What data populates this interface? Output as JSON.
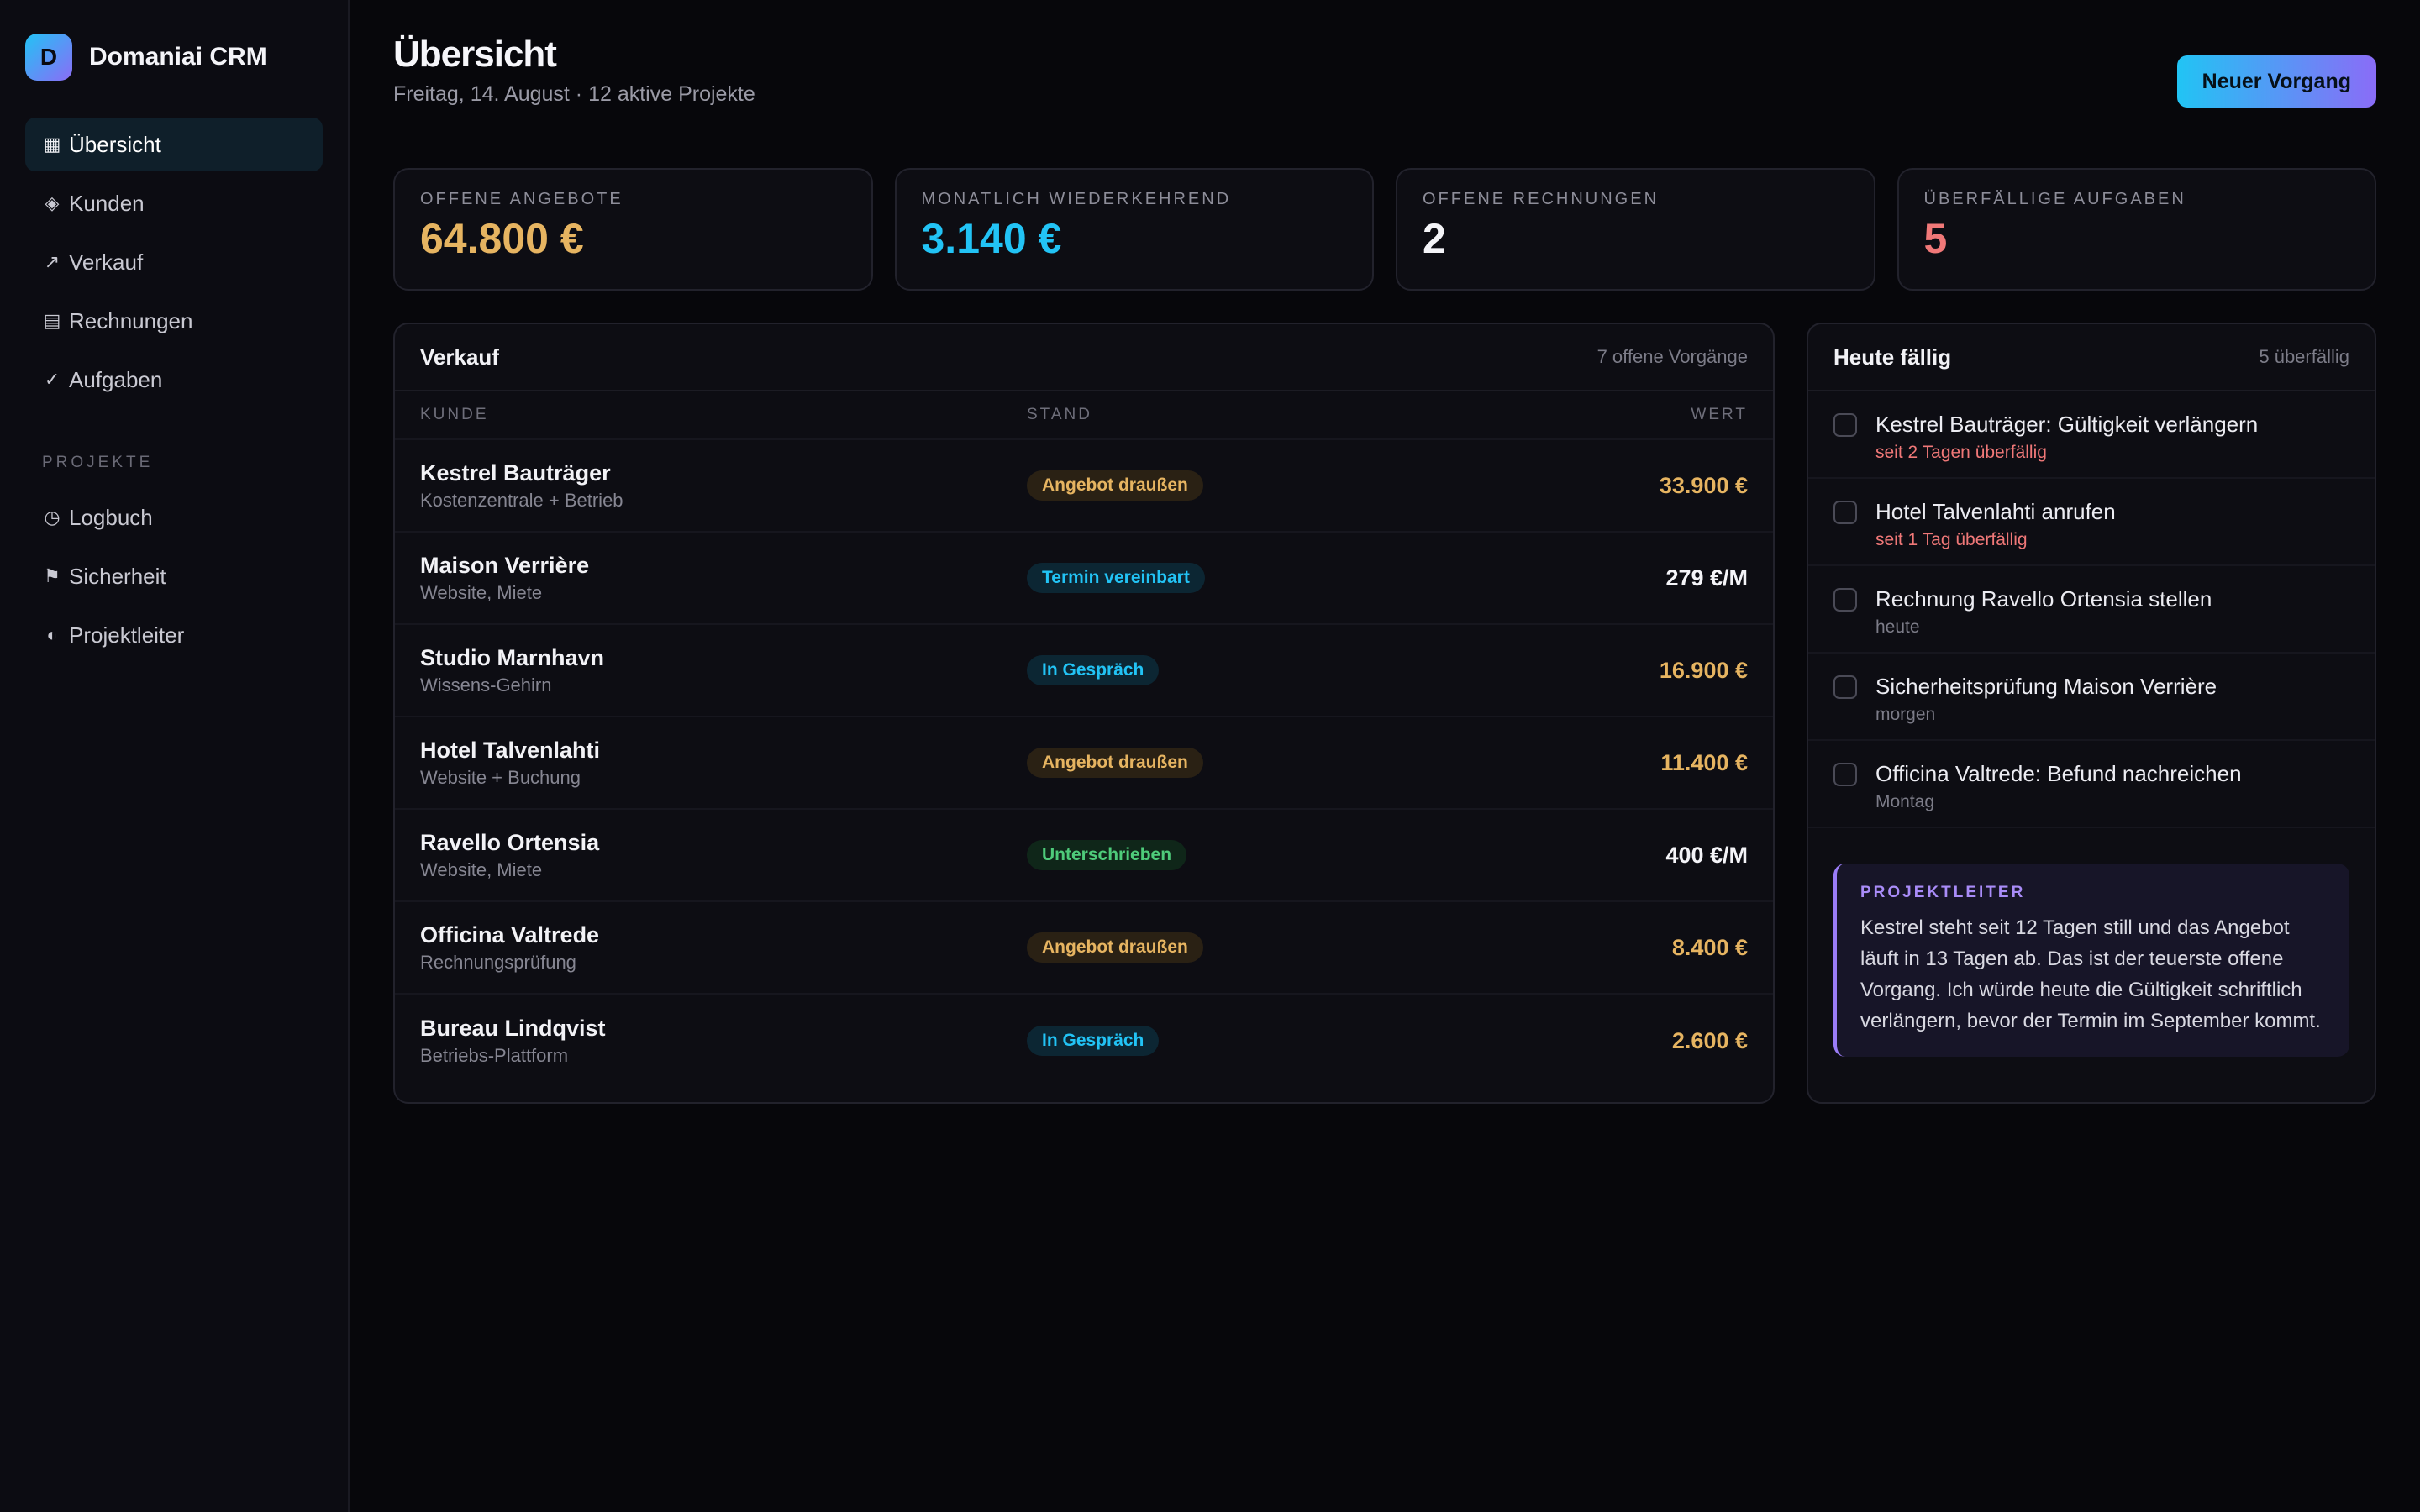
{
  "app": {
    "logo_letter": "D",
    "name": "Domaniai CRM"
  },
  "sidebar": {
    "items": [
      {
        "icon": "▦",
        "label": "Übersicht",
        "active": true
      },
      {
        "icon": "◈",
        "label": "Kunden"
      },
      {
        "icon": "↗",
        "label": "Verkauf"
      },
      {
        "icon": "▤",
        "label": "Rechnungen"
      },
      {
        "icon": "✓",
        "label": "Aufgaben"
      }
    ],
    "section_label": "PROJEKTE",
    "project_items": [
      {
        "icon": "◷",
        "label": "Logbuch"
      },
      {
        "icon": "⚑",
        "label": "Sicherheit"
      },
      {
        "icon": "◐",
        "label": "Projektleiter"
      }
    ]
  },
  "header": {
    "title": "Übersicht",
    "subtitle": "Freitag, 14. August · 12 aktive Projekte",
    "primary_button": "Neuer Vorgang"
  },
  "stats": [
    {
      "label": "OFFENE ANGEBOTE",
      "value": "64.800 €",
      "color": "#e6b461"
    },
    {
      "label": "MONATLICH WIEDERKEHREND",
      "value": "3.140 €",
      "color": "#22c3f5"
    },
    {
      "label": "OFFENE RECHNUNGEN",
      "value": "2",
      "color": "#f4f4f8"
    },
    {
      "label": "ÜBERFÄLLIGE AUFGABEN",
      "value": "5",
      "color": "#f07878"
    }
  ],
  "sales": {
    "title": "Verkauf",
    "meta": "7 offene Vorgänge",
    "columns": {
      "kunde": "KUNDE",
      "stand": "STAND",
      "wert": "WERT"
    },
    "rows": [
      {
        "name": "Kestrel Bauträger",
        "sub": "Kostenzentrale + Betrieb",
        "status": "Angebot draußen",
        "status_type": "offer",
        "value": "33.900 €",
        "value_type": "amber"
      },
      {
        "name": "Maison Verrière",
        "sub": "Website, Miete",
        "status": "Termin vereinbart",
        "status_type": "meeting",
        "value": "279 €/M",
        "value_type": "white"
      },
      {
        "name": "Studio Marnhavn",
        "sub": "Wissens-Gehirn",
        "status": "In Gespräch",
        "status_type": "talk",
        "value": "16.900 €",
        "value_type": "amber"
      },
      {
        "name": "Hotel Talvenlahti",
        "sub": "Website + Buchung",
        "status": "Angebot draußen",
        "status_type": "offer",
        "value": "11.400 €",
        "value_type": "amber"
      },
      {
        "name": "Ravello Ortensia",
        "sub": "Website, Miete",
        "status": "Unterschrieben",
        "status_type": "signed",
        "value": "400 €/M",
        "value_type": "white"
      },
      {
        "name": "Officina Valtrede",
        "sub": "Rechnungsprüfung",
        "status": "Angebot draußen",
        "status_type": "offer",
        "value": "8.400 €",
        "value_type": "amber"
      },
      {
        "name": "Bureau Lindqvist",
        "sub": "Betriebs-Plattform",
        "status": "In Gespräch",
        "status_type": "talk",
        "value": "2.600 €",
        "value_type": "amber"
      }
    ]
  },
  "today": {
    "title": "Heute fällig",
    "meta": "5 überfällig",
    "tasks": [
      {
        "title": "Kestrel Bauträger: Gültigkeit verlängern",
        "sub": "seit 2 Tagen überfällig",
        "overdue": true
      },
      {
        "title": "Hotel Talvenlahti anrufen",
        "sub": "seit 1 Tag überfällig",
        "overdue": true
      },
      {
        "title": "Rechnung Ravello Ortensia stellen",
        "sub": "heute",
        "overdue": false
      },
      {
        "title": "Sicherheitsprüfung Maison Verrière",
        "sub": "morgen",
        "overdue": false
      },
      {
        "title": "Officina Valtrede: Befund nachreichen",
        "sub": "Montag",
        "overdue": false
      }
    ],
    "note": {
      "label": "PROJEKTLEITER",
      "text": "Kestrel steht seit 12 Tagen still und das Angebot läuft in 13 Tagen ab. Das ist der teuerste offene Vorgang. Ich würde heute die Gültigkeit schriftlich verlängern, bevor der Termin im September kommt."
    }
  },
  "colors": {
    "amber": "#e6b461",
    "cyan": "#22c3f5",
    "red": "#f07878",
    "green": "#4ecb7a",
    "violet": "#a98cf8"
  }
}
